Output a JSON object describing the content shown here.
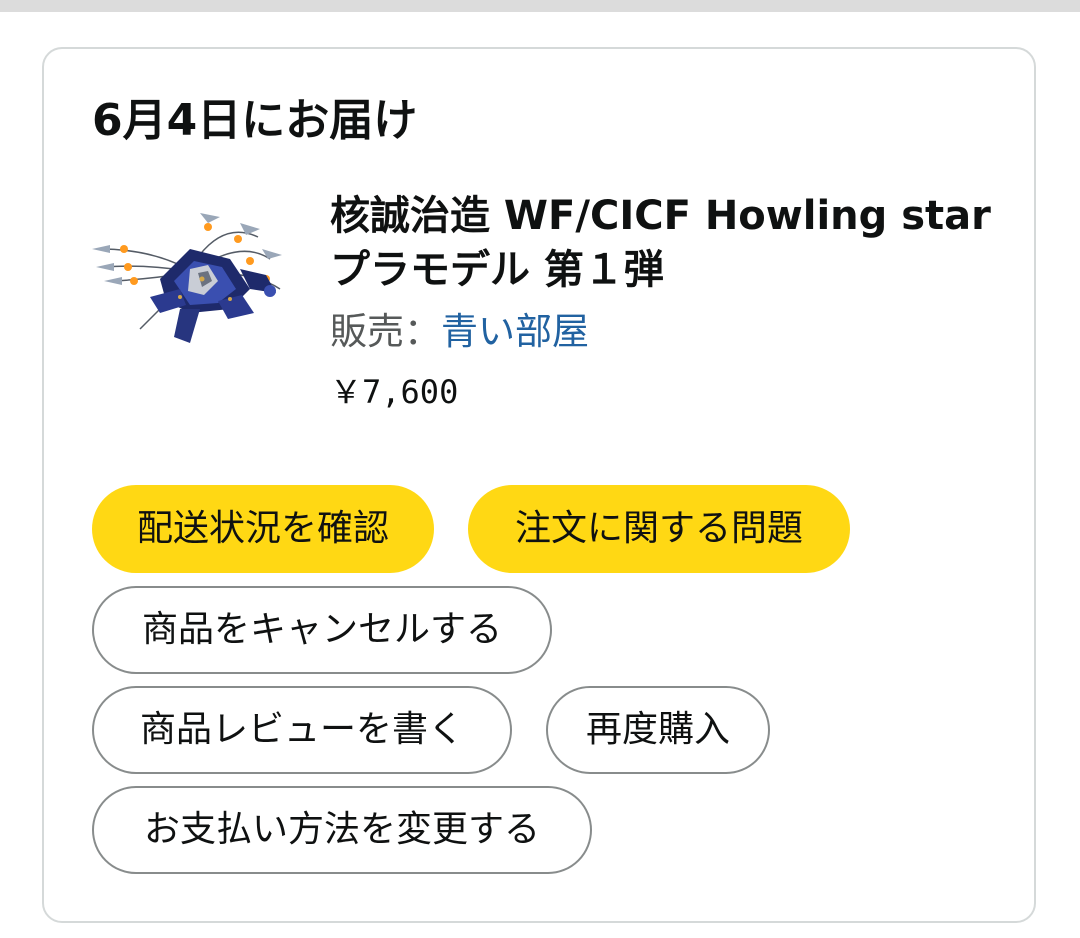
{
  "order": {
    "delivery_title": "6月4日にお届け",
    "product": {
      "title": "核誠治造 WF/CICF Howling star プラモデル 第１弾",
      "seller_label": "販売：",
      "seller_name": "青い部屋",
      "price": "￥7,600",
      "image_icon": "robot-figure-image"
    }
  },
  "actions": {
    "track_package": "配送状況を確認",
    "order_problem": "注文に関する問題",
    "cancel_item": "商品をキャンセルする",
    "write_review": "商品レビューを書く",
    "buy_again": "再度購入",
    "change_payment": "お支払い方法を変更する"
  },
  "colors": {
    "primary_button": "#ffd814",
    "link": "#2162a1",
    "outline_border": "#888c8c",
    "card_border": "#d5d9d9"
  }
}
